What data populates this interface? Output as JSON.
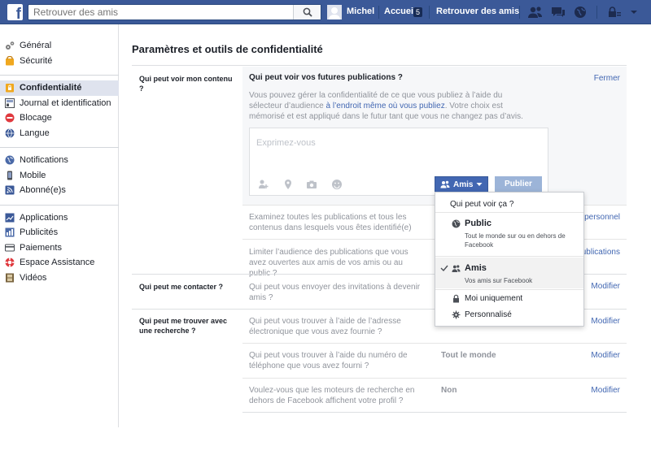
{
  "topbar": {
    "search_placeholder": "Retrouver des amis",
    "user_name": "Michel",
    "home_label": "Accueil",
    "home_badge": "5",
    "find_friends_label": "Retrouver des amis"
  },
  "sidebar": {
    "groups": [
      [
        {
          "label": "Général",
          "icon": "gear-icon"
        },
        {
          "label": "Sécurité",
          "icon": "shield-icon"
        }
      ],
      [
        {
          "label": "Confidentialité",
          "icon": "lock-icon",
          "active": true
        },
        {
          "label": "Journal et identification",
          "icon": "timeline-icon"
        },
        {
          "label": "Blocage",
          "icon": "block-icon"
        },
        {
          "label": "Langue",
          "icon": "globe-icon"
        }
      ],
      [
        {
          "label": "Notifications",
          "icon": "globe-notif-icon"
        },
        {
          "label": "Mobile",
          "icon": "mobile-icon"
        },
        {
          "label": "Abonné(e)s",
          "icon": "rss-icon"
        }
      ],
      [
        {
          "label": "Applications",
          "icon": "apps-icon"
        },
        {
          "label": "Publicités",
          "icon": "ads-icon"
        },
        {
          "label": "Paiements",
          "icon": "card-icon"
        },
        {
          "label": "Espace Assistance",
          "icon": "lifebuoy-icon"
        },
        {
          "label": "Vidéos",
          "icon": "film-icon"
        }
      ]
    ]
  },
  "main": {
    "title": "Paramètres et outils de confidentialité",
    "section1": {
      "label": "Qui peut voir mon contenu ?",
      "expanded_title": "Qui peut voir vos futures publications ?",
      "close_link": "Fermer",
      "expanded_text_1": "Vous pouvez gérer la confidentialité de ce que vous publiez à l’aide du sélecteur d’audience ",
      "expanded_link": "à l’endroit même où vous publiez",
      "expanded_text_2": ". Votre choix est mémorisé et est appliqué dans le futur tant que vous ne changez pas d’avis.",
      "composer_placeholder": "Exprimez-vous",
      "audience_button": "Amis",
      "publish_button": "Publier",
      "row2_desc": "Examinez toutes les publications et tous les contenus dans lesquels vous êtes identifié(e)",
      "row2_link": "personnel",
      "row3_desc": "Limiter l’audience des publications que vous avez ouvertes aux amis de vos amis ou au public ?",
      "row3_link": "ublications"
    },
    "section2": {
      "label": "Qui peut me contacter ?",
      "desc": "Qui peut vous envoyer des invitations à devenir amis ?",
      "link": "Modifier"
    },
    "section3": {
      "label": "Qui peut me trouver avec une recherche ?",
      "rows": [
        {
          "desc": "Qui peut vous trouver à l’aide de l’adresse électronique que vous avez fournie ?",
          "value": "",
          "link": "Modifier"
        },
        {
          "desc": "Qui peut vous trouver à l’aide du numéro de téléphone que vous avez fourni ?",
          "value": "Tout le monde",
          "link": "Modifier"
        },
        {
          "desc": "Voulez-vous que les moteurs de recherche en dehors de Facebook affichent votre profil ?",
          "value": "Non",
          "link": "Modifier"
        }
      ]
    }
  },
  "dropdown": {
    "header": "Qui peut voir ça ?",
    "public_title": "Public",
    "public_sub": "Tout le monde sur ou en dehors de Facebook",
    "friends_title": "Amis",
    "friends_sub": "Vos amis sur Facebook",
    "only_me": "Moi uniquement",
    "custom": "Personnalisé"
  },
  "colors": {
    "brand": "#3b5998",
    "link": "#4267b2",
    "sidebar_active": "#dfe3ee"
  }
}
